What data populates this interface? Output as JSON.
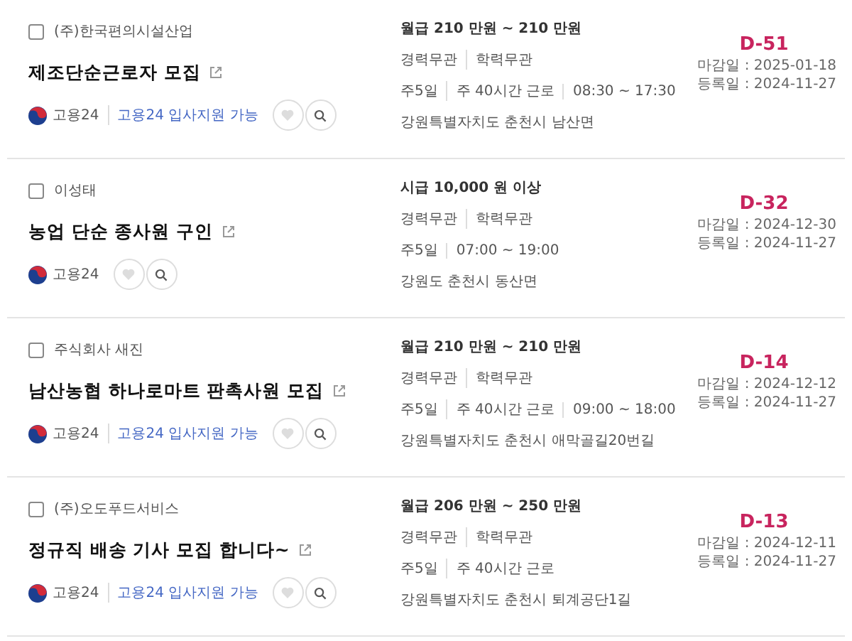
{
  "postings": [
    {
      "company": "(주)한국편의시설산업",
      "checked": false,
      "title": "제조단순근로자 모집",
      "source": "고용24",
      "apply_badge": "고용24 입사지원 가능",
      "salary": "월급 210 만원 ~ 210 만원",
      "conditions": [
        "경력무관",
        "학력무관"
      ],
      "schedule": [
        "주5일",
        "주 40시간 근로",
        "08:30 ~ 17:30"
      ],
      "address": "강원특별자치도 춘천시 남산면",
      "dday": "D-51",
      "deadline": "마감일 : 2025-01-18",
      "registered": "등록일 : 2024-11-27"
    },
    {
      "company": "이성태",
      "checked": false,
      "title": "농업 단순 종사원 구인",
      "source": "고용24",
      "salary": "시급 10,000 원 이상",
      "conditions": [
        "경력무관",
        "학력무관"
      ],
      "schedule": [
        "주5일",
        "07:00 ~ 19:00"
      ],
      "address": "강원도 춘천시 동산면",
      "dday": "D-32",
      "deadline": "마감일 : 2024-12-30",
      "registered": "등록일 : 2024-11-27"
    },
    {
      "company": "주식회사 새진",
      "checked": false,
      "title": "남산농협 하나로마트 판촉사원 모집",
      "source": "고용24",
      "apply_badge": "고용24 입사지원 가능",
      "salary": "월급 210 만원 ~ 210 만원",
      "conditions": [
        "경력무관",
        "학력무관"
      ],
      "schedule": [
        "주5일",
        "주 40시간 근로",
        "09:00 ~ 18:00"
      ],
      "address": "강원특별자치도 춘천시 애막골길20번길",
      "dday": "D-14",
      "deadline": "마감일 : 2024-12-12",
      "registered": "등록일 : 2024-11-27"
    },
    {
      "company": "(주)오도푸드서비스",
      "checked": false,
      "title": "정규직 배송 기사 모집 합니다~",
      "source": "고용24",
      "apply_badge": "고용24 입사지원 가능",
      "salary": "월급 206 만원 ~ 250 만원",
      "conditions": [
        "경력무관",
        "학력무관"
      ],
      "schedule": [
        "주5일",
        "주 40시간 근로"
      ],
      "address": "강원특별자치도 춘천시 퇴계공단1길",
      "dday": "D-13",
      "deadline": "마감일 : 2024-12-11",
      "registered": "등록일 : 2024-11-27"
    }
  ]
}
